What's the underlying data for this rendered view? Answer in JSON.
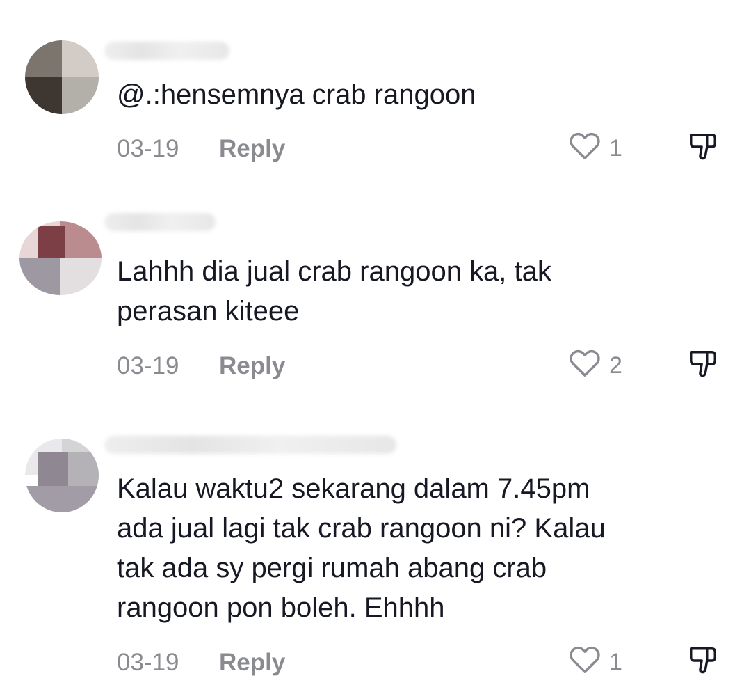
{
  "comments": [
    {
      "text": "@.:hensemnya crab rangoon",
      "date": "03-19",
      "reply_label": "Reply",
      "like_count": "1",
      "avatar_colors": [
        "#7c756e",
        "#d2cbc6",
        "#3e3631",
        "#b3afa9"
      ]
    },
    {
      "text": "Lahhh dia jual crab rangoon ka, tak\nperasan kiteee",
      "date": "03-19",
      "reply_label": "Reply",
      "like_count": "2",
      "avatar_colors": [
        "#e6d6d6",
        "#7c3f45",
        "#bb8c8f",
        "#9e98a2"
      ]
    },
    {
      "text": "Kalau waktu2 sekarang dalam 7.45pm\nada jual lagi tak crab rangoon ni? Kalau\ntak ada sy pergi rumah abang crab\nrangoon pon boleh. Ehhhh",
      "date": "03-19",
      "reply_label": "Reply",
      "like_count": "1",
      "avatar_colors": [
        "#b5b2b7",
        "#8f8791",
        "#a19ca5",
        "#d4d4d6"
      ]
    }
  ],
  "icons": {
    "like": "heart-outline-icon",
    "dislike": "thumbs-down-icon"
  },
  "colors": {
    "text": "#161823",
    "muted": "#8a8b91",
    "background": "#ffffff"
  }
}
